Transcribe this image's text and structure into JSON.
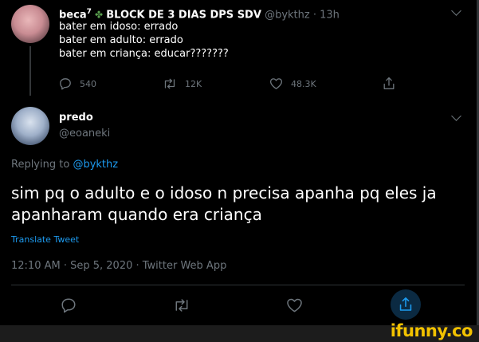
{
  "colors": {
    "background": "#000000",
    "text": "#ffffff",
    "muted": "#6e767d",
    "link": "#1d9bf0",
    "watermark": "#f2c200"
  },
  "parent_tweet": {
    "display_name": "beca",
    "name_superscript": "7",
    "name_suffix": "BLOCK DE 3 DIAS DPS SDV",
    "handle": "@bykthz",
    "time": "13h",
    "lines": [
      "bater em idoso: errado",
      "bater em adulto: errado",
      "bater em criança: educar???????"
    ],
    "replies": "540",
    "retweets": "12K",
    "likes": "48.3K"
  },
  "reply_tweet": {
    "display_name": "predo",
    "handle": "@eoaneki",
    "replying_prefix": "Replying to",
    "replying_handle": "@bykthz",
    "text": "sim pq o adulto e o idoso n precisa apanha pq eles ja apanharam quando era criança",
    "translate_label": "Translate Tweet",
    "timestamp": "12:10 AM · Sep 5, 2020 · Twitter Web App"
  },
  "icons": {
    "reply": "reply-icon",
    "retweet": "retweet-icon",
    "like": "heart-icon",
    "share": "share-icon",
    "more": "chevron-down-icon"
  },
  "watermark": "ifunny.co"
}
